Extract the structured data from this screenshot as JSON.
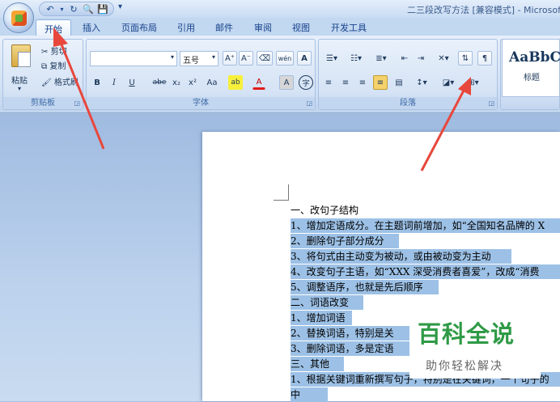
{
  "window": {
    "title": "二三段改写方法 [兼容模式] - Microsoft"
  },
  "quick_access": {
    "undo_icon": "undo-icon",
    "redo_icon": "redo-icon",
    "print_preview_icon": "print-preview-icon",
    "save_icon": "save-icon",
    "more": "▾"
  },
  "tabs": [
    "开始",
    "插入",
    "页面布局",
    "引用",
    "邮件",
    "审阅",
    "视图",
    "开发工具"
  ],
  "clipboard": {
    "paste_label": "粘贴",
    "cut_label": "剪切",
    "copy_label": "复制",
    "format_painter_label": "格式刷",
    "group_label": "剪贴板"
  },
  "font": {
    "font_name": "",
    "font_size": "五号",
    "grow_label": "A⁺",
    "shrink_label": "A⁻",
    "phonetic_label": "wén",
    "border_char_label": "A",
    "bold_label": "B",
    "italic_label": "I",
    "underline_label": "U",
    "strike_label": "abe",
    "subscript_label": "x₂",
    "superscript_label": "x²",
    "case_label": "Aa",
    "highlight_label": "ab",
    "color_label": "A",
    "shade_label": "A",
    "enclose_label": "字",
    "group_label": "字体"
  },
  "paragraph": {
    "group_label": "段落"
  },
  "styles": {
    "sample": "AaBbC",
    "name": "标题"
  },
  "document": {
    "lines": [
      "一、改句子结构",
      "1、增加定语成分。在主题词前增加，如“全国知名品牌的 X",
      "2、删除句子部分成分",
      "3、将句式由主动变为被动，或由被动变为主动",
      "4、改变句子主语，如“XXX 深受消费者喜爱”，改成“消费",
      "5、调整语序，也就是先后顺序",
      "二、词语改变",
      "1、增加词语",
      "2、替换词语，特别是关",
      "3、删除词语，多是定语",
      "三、其他",
      "1、根据关键词重新撰写句子，特别是在关键词，一个句子的",
      "中"
    ]
  },
  "watermark": {
    "main": "百科全说",
    "sub": "助你轻松解决"
  },
  "colors": {
    "arrow": "#e8473c",
    "selection": "#9dc1e6",
    "watermark_green": "#2f9a46"
  }
}
